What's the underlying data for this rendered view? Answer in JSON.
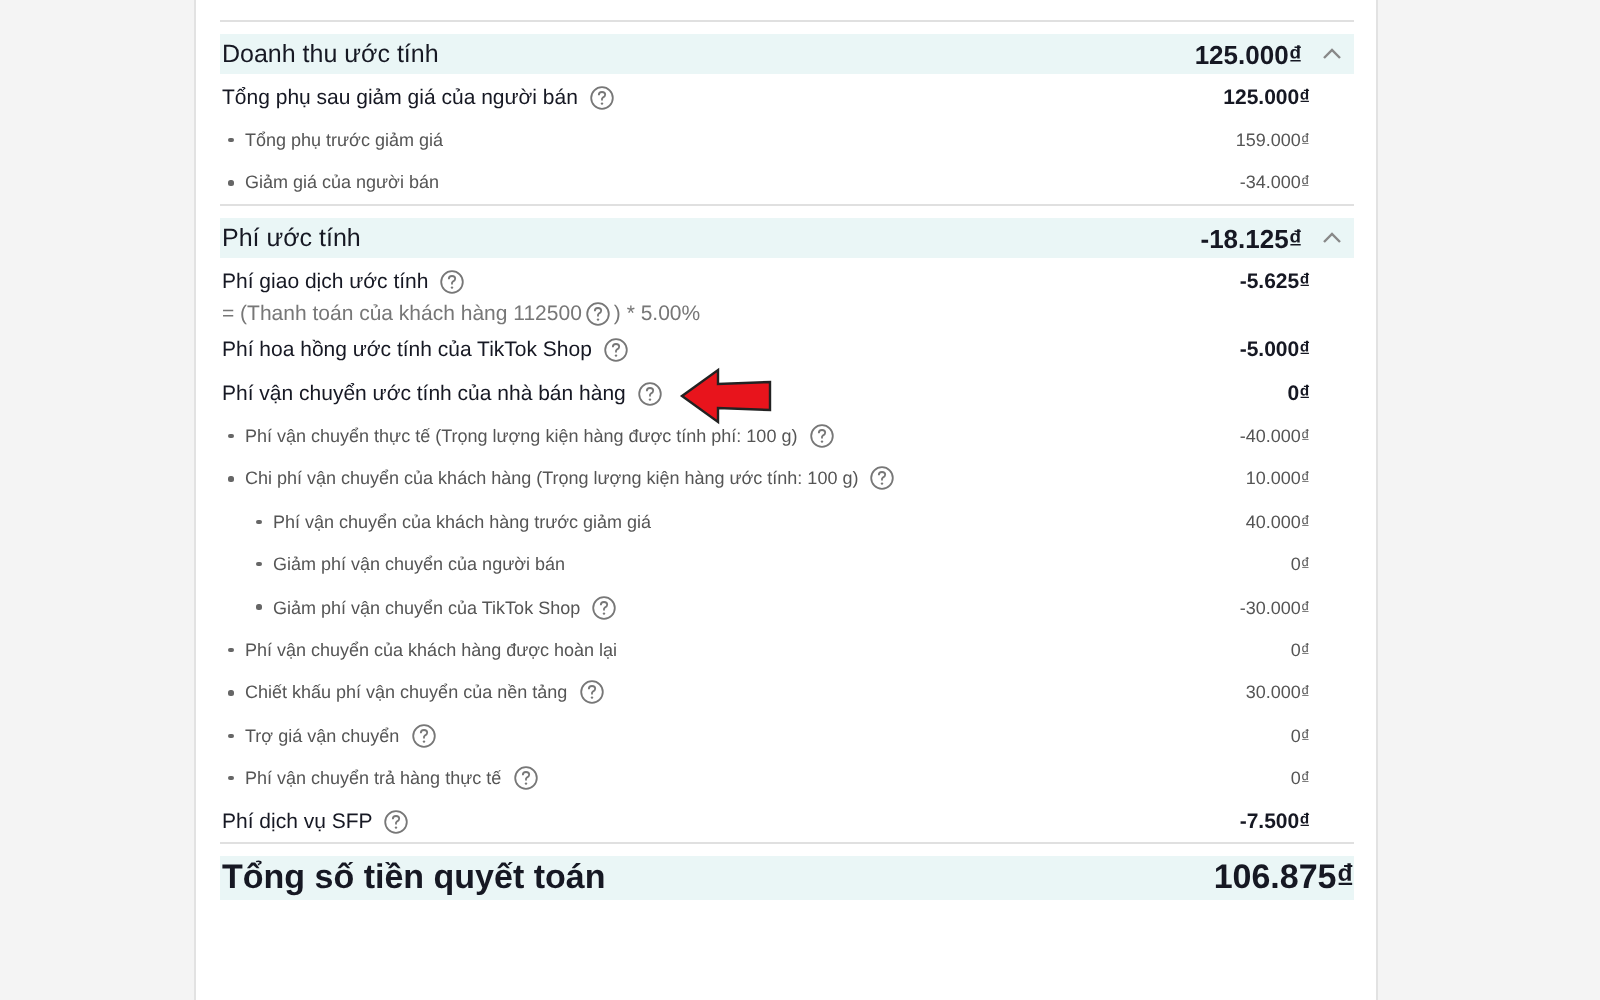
{
  "sections": [
    {
      "title": "Doanh thu ước tính",
      "amount": "125.000₫",
      "expanded": true,
      "rows": [
        {
          "label": "Tổng phụ sau giảm giá của người bán",
          "help": true,
          "amount": "125.000₫",
          "children": [
            {
              "label": "Tổng phụ trước giảm giá",
              "help": false,
              "amount": "159.000₫"
            },
            {
              "label": "Giảm giá của người bán",
              "help": false,
              "amount": "-34.000₫"
            }
          ]
        }
      ]
    },
    {
      "title": "Phí ước tính",
      "amount": "-18.125₫",
      "expanded": true,
      "rows": [
        {
          "label": "Phí giao dịch ước tính",
          "help": true,
          "amount": "-5.625₫",
          "note": {
            "before": "= (Thanh toán của khách hàng 112500",
            "help": true,
            "after": ") * 5.00%"
          }
        },
        {
          "label": "Phí hoa hồng ước tính của TikTok Shop",
          "help": true,
          "amount": "-5.000₫"
        },
        {
          "label": "Phí vận chuyển ước tính của nhà bán hàng",
          "help": true,
          "amount": "0₫",
          "annotated": true,
          "children": [
            {
              "label": "Phí vận chuyển thực tế (Trọng lượng kiện hàng được tính phí: 100 g)",
              "help": true,
              "amount": "-40.000₫"
            },
            {
              "label": "Chi phí vận chuyển của khách hàng (Trọng lượng kiện hàng ước tính: 100 g)",
              "help": true,
              "amount": "10.000₫",
              "children": [
                {
                  "label": "Phí vận chuyển của khách hàng trước giảm giá",
                  "help": false,
                  "amount": "40.000₫"
                },
                {
                  "label": "Giảm phí vận chuyển của người bán",
                  "help": false,
                  "amount": "0₫"
                },
                {
                  "label": "Giảm phí vận chuyển của TikTok Shop",
                  "help": true,
                  "amount": "-30.000₫"
                }
              ]
            },
            {
              "label": "Phí vận chuyển của khách hàng được hoàn lại",
              "help": false,
              "amount": "0₫"
            },
            {
              "label": "Chiết khấu phí vận chuyển của nền tảng",
              "help": true,
              "amount": "30.000₫"
            },
            {
              "label": "Trợ giá vận chuyển",
              "help": true,
              "amount": "0₫"
            },
            {
              "label": "Phí vận chuyển trả hàng thực tế",
              "help": true,
              "amount": "0₫"
            }
          ]
        },
        {
          "label": "Phí dịch vụ SFP",
          "help": true,
          "amount": "-7.500₫"
        }
      ]
    }
  ],
  "total": {
    "label": "Tổng số tiền quyết toán",
    "amount": "106.875₫"
  }
}
